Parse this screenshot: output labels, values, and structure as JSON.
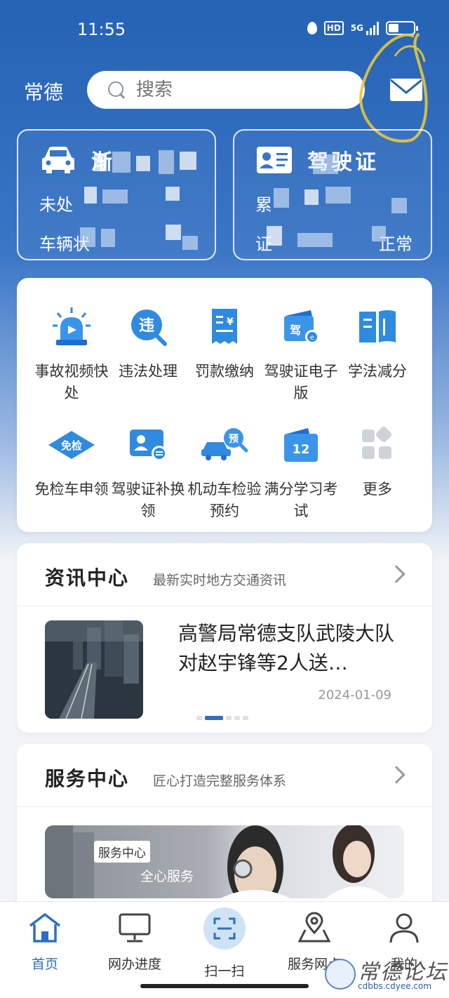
{
  "status_bar": {
    "time": "11:55",
    "network": "5G"
  },
  "header": {
    "city": "常德",
    "search_placeholder": "搜索"
  },
  "cards": {
    "vehicle": {
      "title": "渐",
      "line1": "未处",
      "line2": "车辆状"
    },
    "license": {
      "title": "驾驶证",
      "line1": "累",
      "line2": "证",
      "line2_tail": "正常"
    }
  },
  "services": [
    {
      "label": "事故视频快处",
      "icon": "siren-icon"
    },
    {
      "label": "违法处理",
      "icon": "violation-search-icon"
    },
    {
      "label": "罚款缴纳",
      "icon": "fine-receipt-icon"
    },
    {
      "label": "驾驶证电子版",
      "icon": "e-license-icon"
    },
    {
      "label": "学法减分",
      "icon": "book-icon"
    },
    {
      "label": "免检车申领",
      "icon": "inspection-free-icon"
    },
    {
      "label": "驾驶证补换领",
      "icon": "license-renew-icon"
    },
    {
      "label": "机动车检验预约",
      "icon": "vehicle-inspection-icon"
    },
    {
      "label": "满分学习考试",
      "icon": "calendar-12-icon"
    },
    {
      "label": "更多",
      "icon": "more-grid-icon"
    }
  ],
  "news": {
    "title": "资讯中心",
    "subtitle": "最新实时地方交通资讯",
    "item_title": "高警局常德支队武陵大队对赵宇锋等2人送…",
    "item_date": "2024-01-09"
  },
  "service_center": {
    "title": "服务中心",
    "subtitle": "匠心打造完整服务体系",
    "banner_tag": "服务中心",
    "banner_text": "全心服务"
  },
  "tabbar": [
    {
      "label": "首页",
      "icon": "home-icon",
      "active": true
    },
    {
      "label": "网办进度",
      "icon": "monitor-icon",
      "active": false
    },
    {
      "label": "扫一扫",
      "icon": "scan-icon",
      "active": false
    },
    {
      "label": "服务网点",
      "icon": "map-pin-icon",
      "active": false
    },
    {
      "label": "我的",
      "icon": "user-icon",
      "active": false
    }
  ],
  "watermark": {
    "text": "常德论坛",
    "url": "cdbbs.cdyee.com"
  },
  "colors": {
    "brand_blue": "#2562b4",
    "accent_blue": "#2f6fbe",
    "annotation_yellow": "#e8c73a"
  }
}
